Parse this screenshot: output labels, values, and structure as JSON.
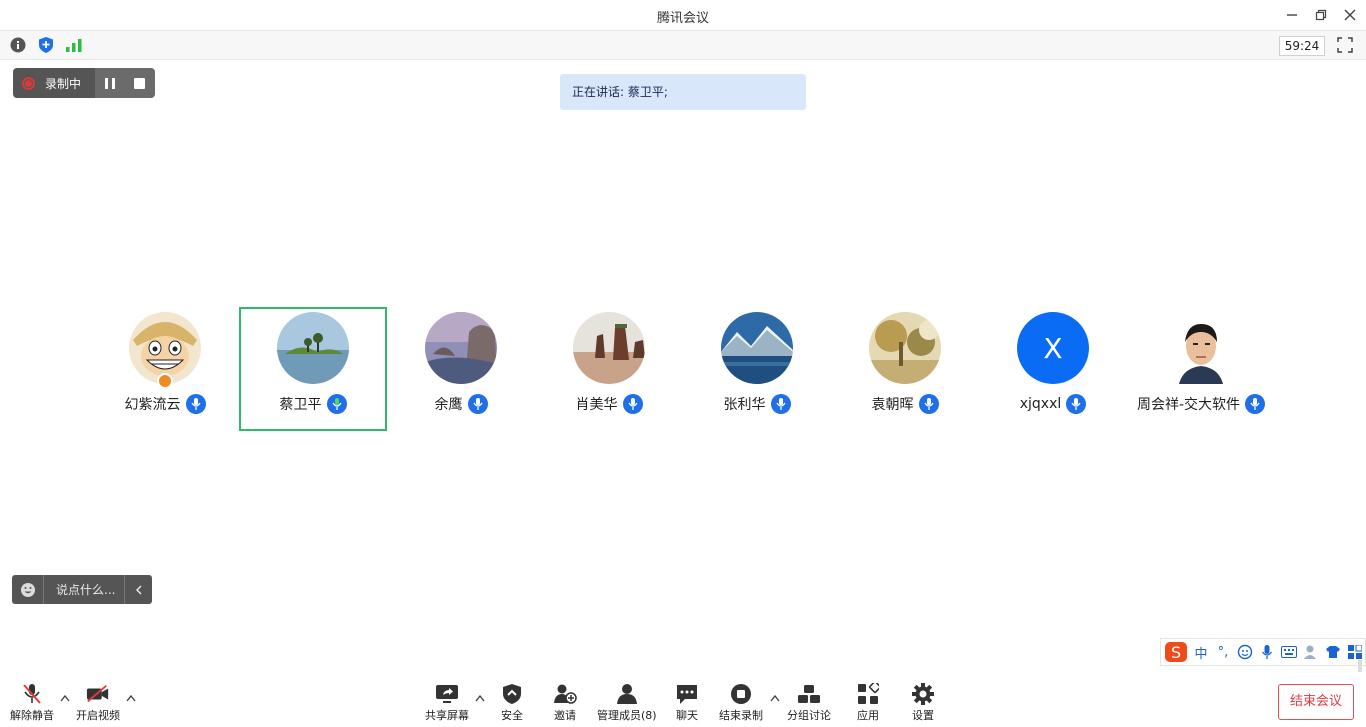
{
  "window": {
    "title": "腾讯会议"
  },
  "infobar": {
    "timer": "59:24"
  },
  "recording": {
    "label": "录制中"
  },
  "speaking": {
    "text": "正在讲话: 蔡卫平;"
  },
  "participants": [
    {
      "name": "幻紫流云",
      "avatar": "anime-face",
      "host": true,
      "active": false
    },
    {
      "name": "蔡卫平",
      "avatar": "lake-island",
      "host": false,
      "active": true
    },
    {
      "name": "余鹰",
      "avatar": "rock-arch",
      "host": false,
      "active": false
    },
    {
      "name": "肖美华",
      "avatar": "sea-stacks",
      "host": false,
      "active": false
    },
    {
      "name": "张利华",
      "avatar": "mountain-lake",
      "host": false,
      "active": false
    },
    {
      "name": "袁朝晖",
      "avatar": "painting",
      "host": false,
      "active": false
    },
    {
      "name": "xjqxxl",
      "avatar": "letter",
      "initial": "X",
      "host": false,
      "active": false
    },
    {
      "name": "周会祥-交大软件",
      "avatar": "photo-man",
      "host": false,
      "active": false
    }
  ],
  "chat": {
    "placeholder": "说点什么..."
  },
  "ime": {
    "mode": "中",
    "punct": "°,"
  },
  "toolbar": {
    "unmute": "解除静音",
    "video": "开启视频",
    "share": "共享屏幕",
    "security": "安全",
    "invite": "邀请",
    "members": "管理成员(8)",
    "chat": "聊天",
    "stop_record": "结束录制",
    "breakout": "分组讨论",
    "apps": "应用",
    "settings": "设置",
    "end": "结束会议"
  },
  "colors": {
    "accent": "#1f6fe8",
    "active_border": "#2dbb6a",
    "end": "#e03c3c"
  }
}
